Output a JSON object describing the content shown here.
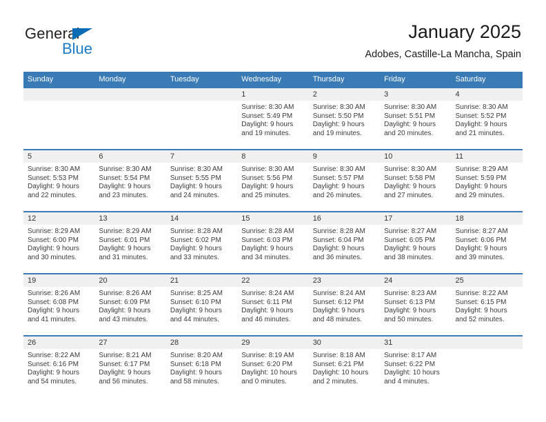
{
  "brand": {
    "name_part1": "General",
    "name_part2": "Blue",
    "flag_icon": "triangle-flag-icon",
    "colors": {
      "blue": "#1a7ac4",
      "flag": "#0a6cb4",
      "dark": "#231f20"
    }
  },
  "header": {
    "title": "January 2025",
    "subtitle": "Adobes, Castille-La Mancha, Spain"
  },
  "theme": {
    "header_blue": "#3a7ab5",
    "day_band_grey": "#f0f0f0",
    "text": "#3a3a3a"
  },
  "calendar": {
    "weekday_headers": [
      "Sunday",
      "Monday",
      "Tuesday",
      "Wednesday",
      "Thursday",
      "Friday",
      "Saturday"
    ],
    "weeks": [
      [
        {
          "day": "",
          "lines": []
        },
        {
          "day": "",
          "lines": []
        },
        {
          "day": "",
          "lines": []
        },
        {
          "day": "1",
          "lines": [
            "Sunrise: 8:30 AM",
            "Sunset: 5:49 PM",
            "Daylight: 9 hours",
            "and 19 minutes."
          ]
        },
        {
          "day": "2",
          "lines": [
            "Sunrise: 8:30 AM",
            "Sunset: 5:50 PM",
            "Daylight: 9 hours",
            "and 19 minutes."
          ]
        },
        {
          "day": "3",
          "lines": [
            "Sunrise: 8:30 AM",
            "Sunset: 5:51 PM",
            "Daylight: 9 hours",
            "and 20 minutes."
          ]
        },
        {
          "day": "4",
          "lines": [
            "Sunrise: 8:30 AM",
            "Sunset: 5:52 PM",
            "Daylight: 9 hours",
            "and 21 minutes."
          ]
        }
      ],
      [
        {
          "day": "5",
          "lines": [
            "Sunrise: 8:30 AM",
            "Sunset: 5:53 PM",
            "Daylight: 9 hours",
            "and 22 minutes."
          ]
        },
        {
          "day": "6",
          "lines": [
            "Sunrise: 8:30 AM",
            "Sunset: 5:54 PM",
            "Daylight: 9 hours",
            "and 23 minutes."
          ]
        },
        {
          "day": "7",
          "lines": [
            "Sunrise: 8:30 AM",
            "Sunset: 5:55 PM",
            "Daylight: 9 hours",
            "and 24 minutes."
          ]
        },
        {
          "day": "8",
          "lines": [
            "Sunrise: 8:30 AM",
            "Sunset: 5:56 PM",
            "Daylight: 9 hours",
            "and 25 minutes."
          ]
        },
        {
          "day": "9",
          "lines": [
            "Sunrise: 8:30 AM",
            "Sunset: 5:57 PM",
            "Daylight: 9 hours",
            "and 26 minutes."
          ]
        },
        {
          "day": "10",
          "lines": [
            "Sunrise: 8:30 AM",
            "Sunset: 5:58 PM",
            "Daylight: 9 hours",
            "and 27 minutes."
          ]
        },
        {
          "day": "11",
          "lines": [
            "Sunrise: 8:29 AM",
            "Sunset: 5:59 PM",
            "Daylight: 9 hours",
            "and 29 minutes."
          ]
        }
      ],
      [
        {
          "day": "12",
          "lines": [
            "Sunrise: 8:29 AM",
            "Sunset: 6:00 PM",
            "Daylight: 9 hours",
            "and 30 minutes."
          ]
        },
        {
          "day": "13",
          "lines": [
            "Sunrise: 8:29 AM",
            "Sunset: 6:01 PM",
            "Daylight: 9 hours",
            "and 31 minutes."
          ]
        },
        {
          "day": "14",
          "lines": [
            "Sunrise: 8:28 AM",
            "Sunset: 6:02 PM",
            "Daylight: 9 hours",
            "and 33 minutes."
          ]
        },
        {
          "day": "15",
          "lines": [
            "Sunrise: 8:28 AM",
            "Sunset: 6:03 PM",
            "Daylight: 9 hours",
            "and 34 minutes."
          ]
        },
        {
          "day": "16",
          "lines": [
            "Sunrise: 8:28 AM",
            "Sunset: 6:04 PM",
            "Daylight: 9 hours",
            "and 36 minutes."
          ]
        },
        {
          "day": "17",
          "lines": [
            "Sunrise: 8:27 AM",
            "Sunset: 6:05 PM",
            "Daylight: 9 hours",
            "and 38 minutes."
          ]
        },
        {
          "day": "18",
          "lines": [
            "Sunrise: 8:27 AM",
            "Sunset: 6:06 PM",
            "Daylight: 9 hours",
            "and 39 minutes."
          ]
        }
      ],
      [
        {
          "day": "19",
          "lines": [
            "Sunrise: 8:26 AM",
            "Sunset: 6:08 PM",
            "Daylight: 9 hours",
            "and 41 minutes."
          ]
        },
        {
          "day": "20",
          "lines": [
            "Sunrise: 8:26 AM",
            "Sunset: 6:09 PM",
            "Daylight: 9 hours",
            "and 43 minutes."
          ]
        },
        {
          "day": "21",
          "lines": [
            "Sunrise: 8:25 AM",
            "Sunset: 6:10 PM",
            "Daylight: 9 hours",
            "and 44 minutes."
          ]
        },
        {
          "day": "22",
          "lines": [
            "Sunrise: 8:24 AM",
            "Sunset: 6:11 PM",
            "Daylight: 9 hours",
            "and 46 minutes."
          ]
        },
        {
          "day": "23",
          "lines": [
            "Sunrise: 8:24 AM",
            "Sunset: 6:12 PM",
            "Daylight: 9 hours",
            "and 48 minutes."
          ]
        },
        {
          "day": "24",
          "lines": [
            "Sunrise: 8:23 AM",
            "Sunset: 6:13 PM",
            "Daylight: 9 hours",
            "and 50 minutes."
          ]
        },
        {
          "day": "25",
          "lines": [
            "Sunrise: 8:22 AM",
            "Sunset: 6:15 PM",
            "Daylight: 9 hours",
            "and 52 minutes."
          ]
        }
      ],
      [
        {
          "day": "26",
          "lines": [
            "Sunrise: 8:22 AM",
            "Sunset: 6:16 PM",
            "Daylight: 9 hours",
            "and 54 minutes."
          ]
        },
        {
          "day": "27",
          "lines": [
            "Sunrise: 8:21 AM",
            "Sunset: 6:17 PM",
            "Daylight: 9 hours",
            "and 56 minutes."
          ]
        },
        {
          "day": "28",
          "lines": [
            "Sunrise: 8:20 AM",
            "Sunset: 6:18 PM",
            "Daylight: 9 hours",
            "and 58 minutes."
          ]
        },
        {
          "day": "29",
          "lines": [
            "Sunrise: 8:19 AM",
            "Sunset: 6:20 PM",
            "Daylight: 10 hours",
            "and 0 minutes."
          ]
        },
        {
          "day": "30",
          "lines": [
            "Sunrise: 8:18 AM",
            "Sunset: 6:21 PM",
            "Daylight: 10 hours",
            "and 2 minutes."
          ]
        },
        {
          "day": "31",
          "lines": [
            "Sunrise: 8:17 AM",
            "Sunset: 6:22 PM",
            "Daylight: 10 hours",
            "and 4 minutes."
          ]
        },
        {
          "day": "",
          "lines": []
        }
      ]
    ]
  }
}
